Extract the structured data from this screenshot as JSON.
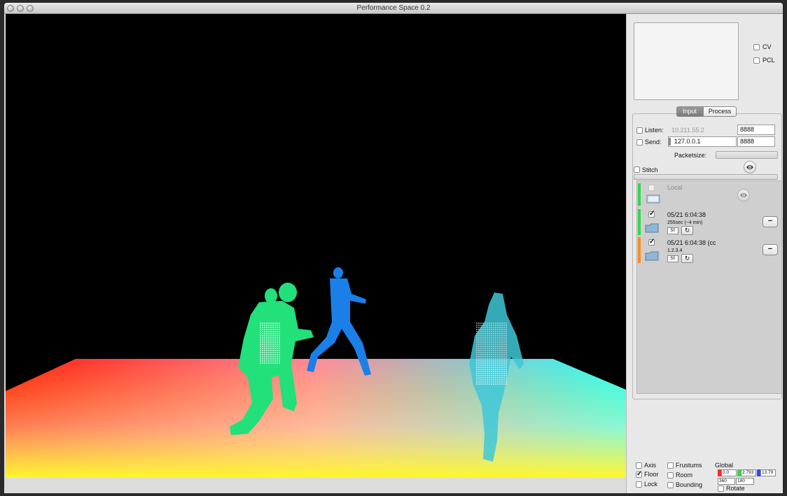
{
  "window": {
    "title": "Performance Space 0.2"
  },
  "panel": {
    "cv_label": "CV",
    "pcl_label": "PCL",
    "tabs": {
      "input": "Input",
      "process": "Process"
    },
    "listen": {
      "label": "Listen:",
      "ip": "10.211.55.2",
      "port": "8888",
      "checked": false
    },
    "send": {
      "label": "Send:",
      "ip": "127.0.0.1",
      "port": "8888",
      "checked": false
    },
    "packetsize_label": "Packetsize:",
    "stitch_label": "Stitch",
    "streams": [
      {
        "title": "Local",
        "detail": "",
        "enabled": false,
        "bar_color": "#2fd84a"
      },
      {
        "title": "05/21 6:04:38",
        "detail": "255sec (~4 min)",
        "value": "50",
        "enabled": true,
        "bar_color": "#2fd84a"
      },
      {
        "title": "05/21 6:04:38 (cc",
        "detail": "1.2.3.4",
        "value": "50",
        "enabled": true,
        "bar_color": "#ff8a1e"
      }
    ],
    "view_options": {
      "axis": {
        "label": "Axis",
        "checked": false
      },
      "floor": {
        "label": "Floor",
        "checked": true
      },
      "lock": {
        "label": "Lock",
        "checked": false
      },
      "frustums": {
        "label": "Frustums",
        "checked": false
      },
      "room": {
        "label": "Room",
        "checked": false
      },
      "bounding": {
        "label": "Bounding",
        "checked": false
      }
    },
    "global": {
      "label": "Global",
      "x": "0.0",
      "y": "2.793",
      "z": "13.79",
      "rot_a": "360",
      "rot_b": "180",
      "rotate_label": "Rotate",
      "colors": {
        "x": "#ff2a2a",
        "y": "#2fd84a",
        "z": "#2a4cff"
      }
    }
  },
  "colors": {
    "floor_top_left": "#ff1a10",
    "floor_top_right": "#20ffff",
    "floor_bottom": "#fff62a",
    "figure_green": "#22e07a",
    "figure_blue": "#1a80e8",
    "figure_cyan": "#3fc8d8"
  }
}
